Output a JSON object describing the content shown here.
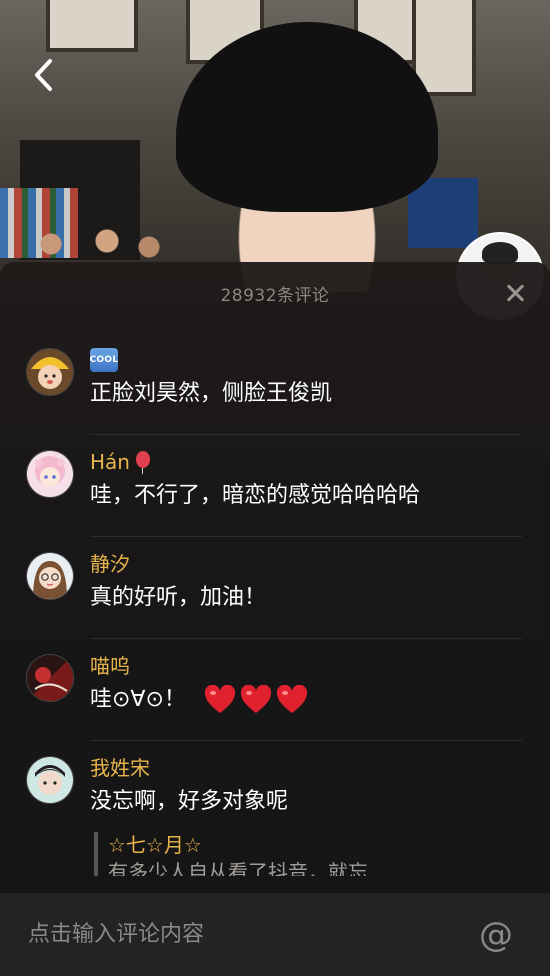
{
  "header": {
    "comment_count": "28932条评论"
  },
  "comments": [
    {
      "author": "",
      "author_badge": "COOL",
      "text": "正脸刘昊然，侧脸王俊凯",
      "avatar": "avatar-yellow-hat"
    },
    {
      "author": "Hán",
      "author_emoji": "balloon",
      "text": "哇，不行了，暗恋的感觉哈哈哈哈",
      "avatar": "avatar-pink-anime"
    },
    {
      "author": "静汐",
      "text": "真的好听，加油！",
      "avatar": "avatar-glasses-girl"
    },
    {
      "author": "喵呜",
      "text": "哇⊙∀⊙！",
      "emojis": [
        "heart",
        "heart",
        "heart"
      ],
      "avatar": "avatar-red-dark"
    },
    {
      "author": "我姓宋",
      "text": "没忘啊，好多对象呢",
      "avatar": "avatar-boy",
      "reply": {
        "author": "☆七☆月☆",
        "text": "有多少人自从看了抖音，就忘"
      }
    }
  ],
  "input": {
    "placeholder": "点击输入评论内容",
    "at_label": "@"
  },
  "colors": {
    "author": "#e8b54c",
    "panel_bg": "#1c1a1a",
    "muted_text": "#8a8680",
    "heart": "#e0212e"
  },
  "icons": {
    "back": "chevron-left-icon",
    "close": "close-icon",
    "at": "at-icon"
  }
}
